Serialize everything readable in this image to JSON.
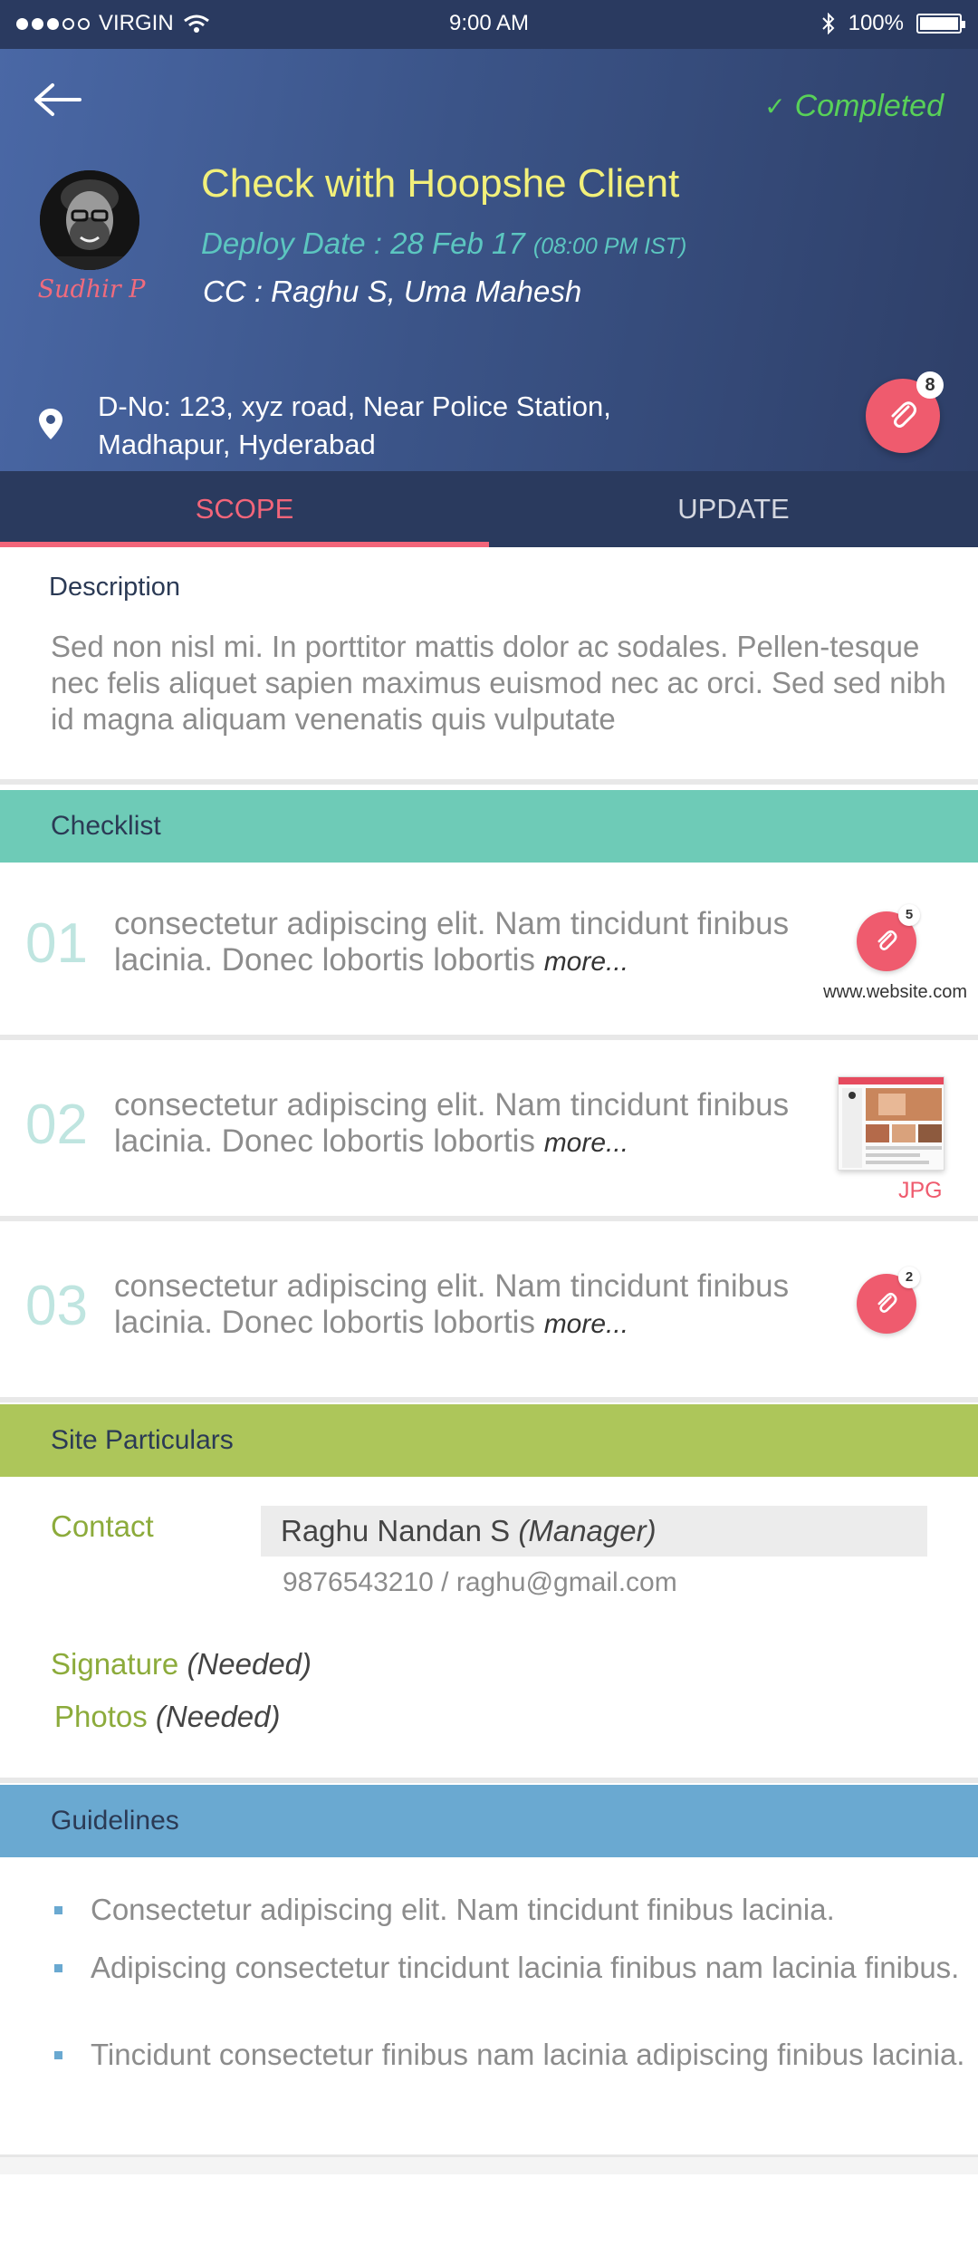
{
  "status_bar": {
    "carrier": "VIRGIN",
    "time": "9:00 AM",
    "battery": "100%"
  },
  "header": {
    "status": "Completed",
    "owner_name": "Sudhir P",
    "title": "Check with Hoopshe Client",
    "deploy_label": "Deploy Date : 28 Feb 17",
    "deploy_time": "(08:00 PM IST)",
    "cc": "CC : Raghu S, Uma Mahesh",
    "address_line1": "D-No: 123, xyz road, Near Police Station,",
    "address_line2": "Madhapur, Hyderabad",
    "attachment_count": "8"
  },
  "tabs": [
    {
      "label": "SCOPE",
      "active": true
    },
    {
      "label": "UPDATE",
      "active": false
    }
  ],
  "description": {
    "label": "Description",
    "text": "Sed non nisl mi. In porttitor mattis dolor ac sodales. Pellen-tesque nec felis aliquet sapien maximus euismod nec ac orci. Sed sed nibh id magna aliquam venenatis quis vulputate"
  },
  "checklist": {
    "title": "Checklist",
    "items": [
      {
        "num": "01",
        "text": "consectetur adipiscing elit. Nam tincidunt finibus lacinia. Donec lobortis lobortis",
        "more": "more...",
        "badge": "5",
        "link": "www.website.com"
      },
      {
        "num": "02",
        "text": "consectetur adipiscing elit. Nam tincidunt finibus lacinia. Donec lobortis lobortis",
        "more": "more...",
        "file_type": "JPG"
      },
      {
        "num": "03",
        "text": "consectetur adipiscing elit. Nam tincidunt finibus lacinia. Donec lobortis lobortis",
        "more": "more...",
        "badge": "2"
      }
    ]
  },
  "site": {
    "title": "Site Particulars",
    "contact_label": "Contact",
    "contact_name": "Raghu Nandan S",
    "contact_role": "(Manager)",
    "contact_info": "9876543210 / raghu@gmail.com",
    "signature_label": "Signature",
    "signature_status": "(Needed)",
    "photos_label": "Photos",
    "photos_status": "(Needed)"
  },
  "guidelines": {
    "title": "Guidelines",
    "items": [
      "Consectetur adipiscing elit. Nam tincidunt finibus lacinia.",
      "Adipiscing consectetur tincidunt lacinia finibus nam lacinia finibus.",
      "Tincidunt consectetur finibus nam lacinia adipiscing finibus lacinia."
    ]
  },
  "colors": {
    "header_start": "#4a68a6",
    "header_end": "#2e3f68",
    "accent_pink": "#ef5b6e",
    "completed_green": "#58d158",
    "checklist_bar": "#6ecbb7",
    "site_bar": "#adc65a",
    "guidelines_bar": "#6aa9d1"
  }
}
